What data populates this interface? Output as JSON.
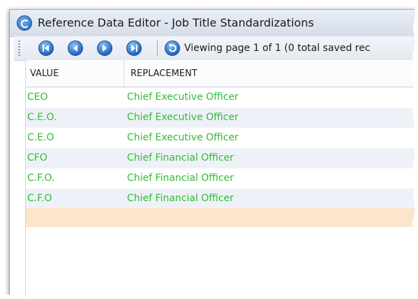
{
  "window": {
    "title": "Reference Data Editor - Job Title Standardizations"
  },
  "toolbar": {
    "buttons": [
      {
        "name": "first-page",
        "icon": "first-page-icon"
      },
      {
        "name": "previous-page",
        "icon": "previous-page-icon"
      },
      {
        "name": "next-page",
        "icon": "next-page-icon"
      },
      {
        "name": "last-page",
        "icon": "last-page-icon"
      },
      {
        "name": "refresh",
        "icon": "refresh-icon"
      }
    ],
    "status_text": "Viewing page 1 of 1 (0 total saved rec"
  },
  "grid": {
    "columns": [
      "VALUE",
      "REPLACEMENT"
    ],
    "rows": [
      {
        "value": "CEO",
        "replacement": "Chief Executive Officer"
      },
      {
        "value": "C.E.O.",
        "replacement": "Chief Executive Officer"
      },
      {
        "value": "C.E.O",
        "replacement": "Chief Executive Officer"
      },
      {
        "value": "CFO",
        "replacement": "Chief Financial Officer"
      },
      {
        "value": "C.F.O.",
        "replacement": "Chief Financial Officer"
      },
      {
        "value": "C.F.O",
        "replacement": "Chief Financial Officer"
      }
    ]
  },
  "colors": {
    "row_text": "#33bb33",
    "new_row_bg": "#fde5cd",
    "alt_row_bg": "#eef2f8",
    "nav_button": "#2266c0"
  }
}
